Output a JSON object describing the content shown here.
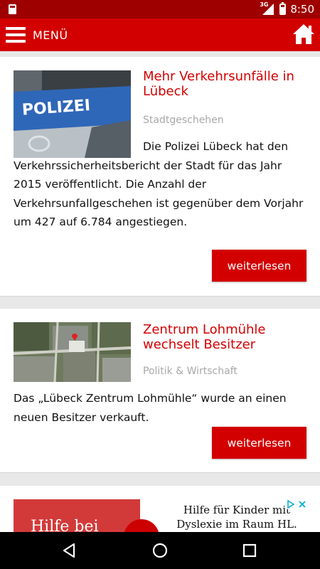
{
  "status_bar": {
    "network": "3G",
    "time": "8:50"
  },
  "app_bar": {
    "menu_label": "MENÜ",
    "menu_icon": "hamburger-icon",
    "home_icon": "home-icon",
    "accent_color": "#d30000"
  },
  "articles": [
    {
      "title": "Mehr Verkehrsunfälle in Lübeck",
      "category": "Stadtgeschehen",
      "excerpt": "Die Polizei Lübeck hat den Verkehrssicherheitsbericht der Stadt für das Jahr 2015 veröffentlicht. Die Anzahl der Verkehrsunfallgeschehen ist gegenüber dem Vorjahr um 427 auf 6.784 angestiegen.",
      "button_label": "weiterlesen",
      "image_text": "POLIZEI"
    },
    {
      "title": "Zentrum Lohmühle wechselt Besitzer",
      "category": "Politik & Wirtschaft",
      "excerpt": "Das „Lübeck Zentrum Lohmühle“ wurde an einen neuen Besitzer verkauft.",
      "button_label": "weiterlesen"
    }
  ],
  "ad": {
    "left_text": "Hilfe bei",
    "right_text": "Hilfe für Kinder mit Dyslexie im Raum HL."
  },
  "nav_bar": {
    "back_icon": "back-icon",
    "home_icon": "home-circle-icon",
    "recents_icon": "recents-icon"
  }
}
